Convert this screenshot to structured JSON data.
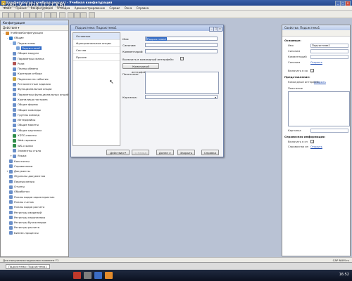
{
  "window": {
    "title": "Конфигуратор (учебная версия) - Учебная конфигурация"
  },
  "menu": [
    "Файл",
    "Правка",
    "Конфигурация",
    "Отладка",
    "Администрирование",
    "Сервис",
    "Окна",
    "Справка"
  ],
  "left_panel": {
    "title": "Конфигурация",
    "actions": "Действия ▾",
    "tree": [
      {
        "label": "УчебнаяКонфигурация",
        "level": 0,
        "expander": "-",
        "icon": "#d88a2d"
      },
      {
        "label": "Общие",
        "level": 1,
        "expander": "-",
        "icon": "#2d78c7"
      },
      {
        "label": "Подсистемы",
        "level": 2,
        "expander": "-",
        "icon": "#7aa3d8"
      },
      {
        "label": "Подсистема1",
        "level": 3,
        "expander": "",
        "icon": "#7aa3d8",
        "selected": true
      },
      {
        "label": "Общие модули",
        "level": 2,
        "expander": "",
        "icon": "#6a8fc9"
      },
      {
        "label": "Параметры сеанса",
        "level": 2,
        "expander": "",
        "icon": "#6a8fc9"
      },
      {
        "label": "Роли",
        "level": 2,
        "expander": "",
        "icon": "#b35353"
      },
      {
        "label": "Планы обмена",
        "level": 2,
        "expander": "",
        "icon": "#6a8fc9"
      },
      {
        "label": "Критерии отбора",
        "level": 2,
        "expander": "",
        "icon": "#6a8fc9"
      },
      {
        "label": "Подписки на события",
        "level": 2,
        "expander": "",
        "icon": "#c9a23a"
      },
      {
        "label": "Регламентные задания",
        "level": 2,
        "expander": "",
        "icon": "#6a8fc9"
      },
      {
        "label": "Функциональные опции",
        "level": 2,
        "expander": "",
        "icon": "#6a8fc9"
      },
      {
        "label": "Параметры функциональных опций",
        "level": 2,
        "expander": "",
        "icon": "#6a8fc9"
      },
      {
        "label": "Хранилища настроек",
        "level": 2,
        "expander": "",
        "icon": "#6a8fc9"
      },
      {
        "label": "Общие формы",
        "level": 2,
        "expander": "",
        "icon": "#6a8fc9"
      },
      {
        "label": "Общие команды",
        "level": 2,
        "expander": "",
        "icon": "#6a8fc9"
      },
      {
        "label": "Группы команд",
        "level": 2,
        "expander": "",
        "icon": "#6a8fc9"
      },
      {
        "label": "Интерфейсы",
        "level": 2,
        "expander": "",
        "icon": "#6a8fc9"
      },
      {
        "label": "Общие макеты",
        "level": 2,
        "expander": "",
        "icon": "#6a8fc9"
      },
      {
        "label": "Общие картинки",
        "level": 2,
        "expander": "",
        "icon": "#6a8fc9"
      },
      {
        "label": "XDTO-пакеты",
        "level": 2,
        "expander": "",
        "icon": "#2f8d4a"
      },
      {
        "label": "Web-сервисы",
        "level": 2,
        "expander": "",
        "icon": "#2f8d4a"
      },
      {
        "label": "WS-ссылки",
        "level": 2,
        "expander": "",
        "icon": "#2f8d4a"
      },
      {
        "label": "Элементы стиля",
        "level": 2,
        "expander": "",
        "icon": "#6a8fc9"
      },
      {
        "label": "Языки",
        "level": 2,
        "expander": "+",
        "icon": "#6a8fc9"
      },
      {
        "label": "Константы",
        "level": 1,
        "expander": "",
        "icon": "#6a8fc9"
      },
      {
        "label": "Справочники",
        "level": 1,
        "expander": "",
        "icon": "#6a8fc9"
      },
      {
        "label": "Документы",
        "level": 1,
        "expander": "+",
        "icon": "#6a8fc9"
      },
      {
        "label": "Журналы документов",
        "level": 1,
        "expander": "",
        "icon": "#6a8fc9"
      },
      {
        "label": "Перечисления",
        "level": 1,
        "expander": "",
        "icon": "#6a8fc9"
      },
      {
        "label": "Отчеты",
        "level": 1,
        "expander": "",
        "icon": "#6a8fc9"
      },
      {
        "label": "Обработки",
        "level": 1,
        "expander": "",
        "icon": "#6a8fc9"
      },
      {
        "label": "Планы видов характеристик",
        "level": 1,
        "expander": "",
        "icon": "#6a8fc9"
      },
      {
        "label": "Планы счетов",
        "level": 1,
        "expander": "",
        "icon": "#6a8fc9"
      },
      {
        "label": "Планы видов расчета",
        "level": 1,
        "expander": "",
        "icon": "#6a8fc9"
      },
      {
        "label": "Регистры сведений",
        "level": 1,
        "expander": "",
        "icon": "#6a8fc9"
      },
      {
        "label": "Регистры накопления",
        "level": 1,
        "expander": "",
        "icon": "#6a8fc9"
      },
      {
        "label": "Регистры бухгалтерии",
        "level": 1,
        "expander": "",
        "icon": "#6a8fc9"
      },
      {
        "label": "Регистры расчета",
        "level": 1,
        "expander": "",
        "icon": "#6a8fc9"
      },
      {
        "label": "Бизнес-процессы",
        "level": 1,
        "expander": "",
        "icon": "#6a8fc9"
      }
    ]
  },
  "dialog": {
    "title": "Подсистема: Подсистема1",
    "nav": [
      "Основные",
      "Функциональные опции",
      "Состав",
      "Прочее"
    ],
    "fields": {
      "name_label": "Имя:",
      "name_value": "Подсистема1",
      "synonym_label": "Синоним:",
      "synonym_value": "",
      "comment_label": "Комментарий:",
      "comment_value": "",
      "include_label": "Включать в командный интерфейс:",
      "include_checked": "✓",
      "cmd_button": "Командный интерфейс...",
      "explain_label": "Пояснение:",
      "picture_label": "Картинка:"
    },
    "buttons": {
      "actions": "Действия ▾",
      "back": "< Назад",
      "next": "Далее >",
      "close": "Закрыть",
      "help": "Справка"
    }
  },
  "right_panel": {
    "title": "Свойства: Подсистема1",
    "sections": {
      "main": "Основные:",
      "name_label": "Имя",
      "name_value": "Подсистема1",
      "synonym_label": "Синоним",
      "comment_label": "Комментарий",
      "syntax_label": "Синоним",
      "syntax_link": "Открыть",
      "include_label": "Включать в ко",
      "presentation": "Представление:",
      "cmd_label": "Командный интерфейс",
      "cmd_link": "Открыть",
      "explain_label": "Пояснение",
      "picture_label": "Картинка",
      "ref_info": "Справочная информация:",
      "ref_label": "Включать в сп",
      "ref_link2": "Справочная ин",
      "ref_link_label": "Открыть"
    }
  },
  "status": {
    "text": "Для получения подсказки нажмите F1",
    "right": "CAP NUM ru"
  },
  "subpanel_tab": "Подсистема: Подсистема1",
  "info_overlay": "1280 × 1024 (127 KB)",
  "taskbar": {
    "clock": "16:52"
  }
}
